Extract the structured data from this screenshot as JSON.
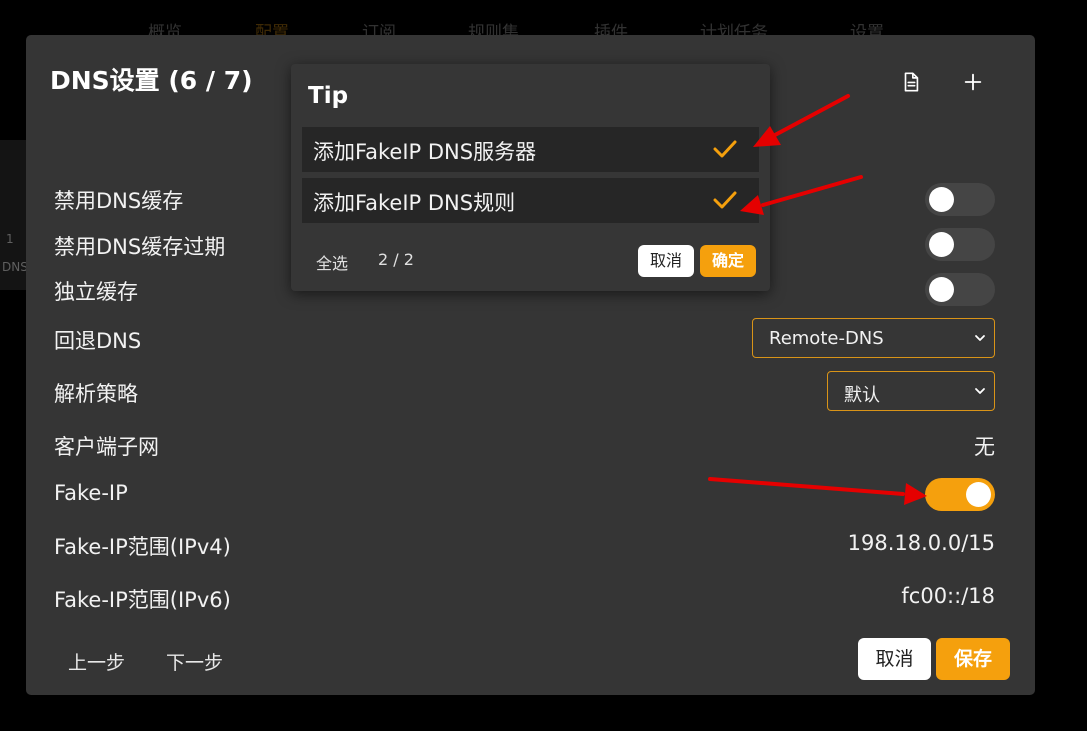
{
  "background_nav": {
    "items": [
      "概览",
      "配置",
      "订阅",
      "规则集",
      "插件",
      "计划任务",
      "设置"
    ],
    "active_index": 1
  },
  "background_side": {
    "line1": "1",
    "line2": "DNS"
  },
  "dialog": {
    "title": "DNS设置 (6 / 7)",
    "header_icons": [
      "document-icon",
      "plus-icon"
    ],
    "rows": {
      "disable_cache": {
        "label": "禁用DNS缓存",
        "enabled": false
      },
      "disable_expire": {
        "label": "禁用DNS缓存过期",
        "enabled": false
      },
      "independent_cache": {
        "label": "独立缓存",
        "enabled": false
      },
      "fallback_dns": {
        "label": "回退DNS",
        "selected": "Remote-DNS"
      },
      "strategy": {
        "label": "解析策略",
        "selected": "默认"
      },
      "client_subnet": {
        "label": "客户端子网",
        "value": "无"
      },
      "fake_ip": {
        "label": "Fake-IP",
        "enabled": true
      },
      "fake_ip_v4": {
        "label": "Fake-IP范围(IPv4)",
        "value": "198.18.0.0/15"
      },
      "fake_ip_v6": {
        "label": "Fake-IP范围(IPv6)",
        "value": "fc00::/18"
      }
    },
    "footer": {
      "prev": "上一步",
      "next": "下一步",
      "cancel": "取消",
      "save": "保存"
    }
  },
  "tip": {
    "title": "Tip",
    "items": [
      {
        "label": "添加FakeIP DNS服务器",
        "checked": true
      },
      {
        "label": "添加FakeIP DNS规则",
        "checked": true
      }
    ],
    "select_all": "全选",
    "count": "2 / 2",
    "cancel": "取消",
    "confirm": "确定"
  },
  "colors": {
    "accent": "#f5a00d",
    "dialog_bg": "#353535",
    "annotation_red": "#e50000"
  }
}
